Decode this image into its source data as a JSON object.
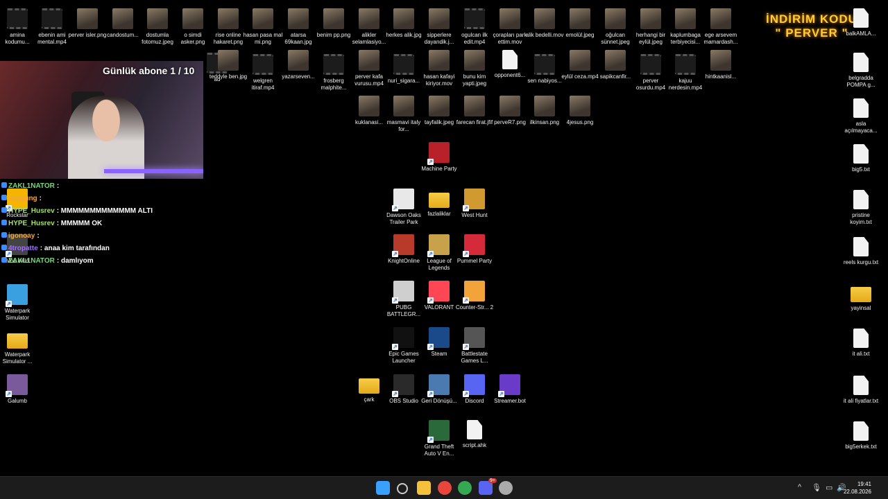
{
  "overlay": {
    "sub_counter": "Günlük abone 1 / 10",
    "promo_line1": "İNDİRİM KODU",
    "promo_line2": "\" PERVER \""
  },
  "chat": [
    {
      "user": "ZAKL1NATOR",
      "user_color": "#7bd57a",
      "message": ":"
    },
    {
      "user": "vusgung",
      "user_color": "#f0a73c",
      "message": ":"
    },
    {
      "user": "HYPE_Husrev",
      "user_color": "#a4e06b",
      "message": ": MMMMMMMMMMMMM ALTI"
    },
    {
      "user": "HYPE_Husrev",
      "user_color": "#a4e06b",
      "message": ": MMMMM OK"
    },
    {
      "user": "igonoay",
      "user_color": "#f0a73c",
      "message": ":"
    },
    {
      "user": "4tropatte",
      "user_color": "#a070ff",
      "message": ": anaa kim tarafından"
    },
    {
      "user": "ZAKL1NATOR",
      "user_color": "#7bd57a",
      "message": ": damlıyom"
    }
  ],
  "desktop_icons": [
    {
      "label": "amina kodumu...",
      "kind": "vid"
    },
    {
      "label": "ebenin ami mental.mp4",
      "kind": "vid"
    },
    {
      "label": "perver isler.png",
      "kind": "img"
    },
    {
      "label": "candostum...",
      "kind": "img"
    },
    {
      "label": "dostumla fotomuz.jpeg",
      "kind": "img"
    },
    {
      "label": "o simdi asker.png",
      "kind": "img"
    },
    {
      "label": "rise online hakaret.png",
      "kind": "img"
    },
    {
      "label": "hasan pasa mal mi.png",
      "kind": "img"
    },
    {
      "label": "atarsa 69kaan.jpg",
      "kind": "img"
    },
    {
      "label": "benim pp.png",
      "kind": "img"
    },
    {
      "label": "alikler selamlasiyo...",
      "kind": "img"
    },
    {
      "label": "herkes alik.jpg",
      "kind": "img"
    },
    {
      "label": "sipperlere dayandik.j...",
      "kind": "img"
    },
    {
      "label": "ogulcan ilk edit.mp4",
      "kind": "vid"
    },
    {
      "label": "çorapları park ettim.mov",
      "kind": "img"
    },
    {
      "label": "alik bedelli.mov",
      "kind": "img"
    },
    {
      "label": "emolül.jpeg",
      "kind": "img"
    },
    {
      "label": "oğulcan sünnet.jpeg",
      "kind": "img"
    },
    {
      "label": "herhangi bir eylül.jpeg",
      "kind": "img"
    },
    {
      "label": "kaplumbaga terbiyecisi...",
      "kind": "img"
    },
    {
      "label": "ege arsevem mamardash...",
      "kind": "img"
    },
    {
      "label": "balkAMLA...",
      "kind": "txt"
    },
    {
      "label": "ad",
      "kind": "vid"
    },
    {
      "label": "teddyle ben.jpg",
      "kind": "img"
    },
    {
      "label": "welgren itiraf.mp4",
      "kind": "vid"
    },
    {
      "label": "yazarseven...",
      "kind": "img"
    },
    {
      "label": "frosberg malphite...",
      "kind": "vid"
    },
    {
      "label": "perver kafa vurusu.mp4",
      "kind": "img"
    },
    {
      "label": "nuri_sigara...",
      "kind": "vid"
    },
    {
      "label": "hasan kafayi kiriyor.mov",
      "kind": "img"
    },
    {
      "label": "bunu kim yapti.jpeg",
      "kind": "img"
    },
    {
      "label": "opponent6...",
      "kind": "txt"
    },
    {
      "label": "sen nabiyos...",
      "kind": "vid"
    },
    {
      "label": "eylül ceza.mp4",
      "kind": "img"
    },
    {
      "label": "sapikcanfir...",
      "kind": "img"
    },
    {
      "label": "perver osurdu.mp4",
      "kind": "vid"
    },
    {
      "label": "kajuu nerdesin.mp4",
      "kind": "vid"
    },
    {
      "label": "hintkaanisl...",
      "kind": "img"
    },
    {
      "label": "belgradda POMPA g...",
      "kind": "txt"
    },
    {
      "label": "kuklanasi...",
      "kind": "img"
    },
    {
      "label": "masmavi italy for...",
      "kind": "img"
    },
    {
      "label": "tayfalik.jpeg",
      "kind": "img"
    },
    {
      "label": "farecan firat.jfif",
      "kind": "img"
    },
    {
      "label": "perveR7.png",
      "kind": "img"
    },
    {
      "label": "ilkinsan.png",
      "kind": "img"
    },
    {
      "label": "4jesus.png",
      "kind": "img"
    },
    {
      "label": "asla açılmayaca...",
      "kind": "txt"
    },
    {
      "label": "Machine Party",
      "kind": "app",
      "color": "#b8202a"
    },
    {
      "label": "big5.txt",
      "kind": "txt"
    },
    {
      "label": "Dawson Oaks Trailer Park",
      "kind": "app",
      "color": "#e8e8e8"
    },
    {
      "label": "fazlaliklar",
      "kind": "folder"
    },
    {
      "label": "West Hunt",
      "kind": "app",
      "color": "#d09a30"
    },
    {
      "label": "pristine koyim.txt",
      "kind": "txt"
    },
    {
      "label": "Rockstar",
      "kind": "app",
      "color": "#f4b400"
    },
    {
      "label": "KnightOnline",
      "kind": "app",
      "color": "#b83a2a"
    },
    {
      "label": "League of Legends",
      "kind": "app",
      "color": "#c8a24a"
    },
    {
      "label": "Pummel Party",
      "kind": "app",
      "color": "#d42a3a"
    },
    {
      "label": "reels kurgu.txt",
      "kind": "txt"
    },
    {
      "label": "Mob Wild",
      "kind": "app",
      "color": "#444"
    },
    {
      "label": "PUBG BATTLEGR...",
      "kind": "app",
      "color": "#cfcfcf"
    },
    {
      "label": "VALORANT",
      "kind": "app",
      "color": "#ff4655"
    },
    {
      "label": "Counter-Str... 2",
      "kind": "app",
      "color": "#f2a43a"
    },
    {
      "label": "yayinsal",
      "kind": "folder"
    },
    {
      "label": "Waterpark Simulator",
      "kind": "app",
      "color": "#3aa0e0"
    },
    {
      "label": "Epic Games Launcher",
      "kind": "app",
      "color": "#111"
    },
    {
      "label": "Steam",
      "kind": "app",
      "color": "#1b4a8a"
    },
    {
      "label": "Battlestate Games L...",
      "kind": "app",
      "color": "#555"
    },
    {
      "label": "it ali.txt",
      "kind": "txt"
    },
    {
      "label": "Waterpark Simulator ...",
      "kind": "folder"
    },
    {
      "label": "Galumb",
      "kind": "app",
      "color": "#7a5a9a"
    },
    {
      "label": "çark",
      "kind": "folder"
    },
    {
      "label": "OBS Studio",
      "kind": "app",
      "color": "#2a2a2a"
    },
    {
      "label": "Geri Dönüşü...",
      "kind": "app",
      "color": "#4a7ab0"
    },
    {
      "label": "Discord",
      "kind": "app",
      "color": "#5865f2"
    },
    {
      "label": "Streamer.bot",
      "kind": "app",
      "color": "#6a3ac8"
    },
    {
      "label": "it ali fiyatlar.txt",
      "kind": "txt"
    },
    {
      "label": "Grand Theft Auto V En...",
      "kind": "app",
      "color": "#2a6a3a"
    },
    {
      "label": "script.ahk",
      "kind": "txt"
    },
    {
      "label": "big5erkek.txt",
      "kind": "txt"
    }
  ],
  "taskbar": {
    "apps": [
      {
        "name": "start",
        "color": "#3aa0ff"
      },
      {
        "name": "search",
        "color": "#cccccc"
      },
      {
        "name": "explorer",
        "color": "#f4c23a"
      },
      {
        "name": "chrome",
        "color": "#e8453c"
      },
      {
        "name": "chrome-2",
        "color": "#34a853"
      },
      {
        "name": "discord",
        "color": "#5865f2"
      },
      {
        "name": "obs",
        "color": "#aaaaaa"
      }
    ],
    "discord_badge": "9+",
    "tray_chevron": "^",
    "time": "19:41",
    "date": "22.08.2026"
  }
}
